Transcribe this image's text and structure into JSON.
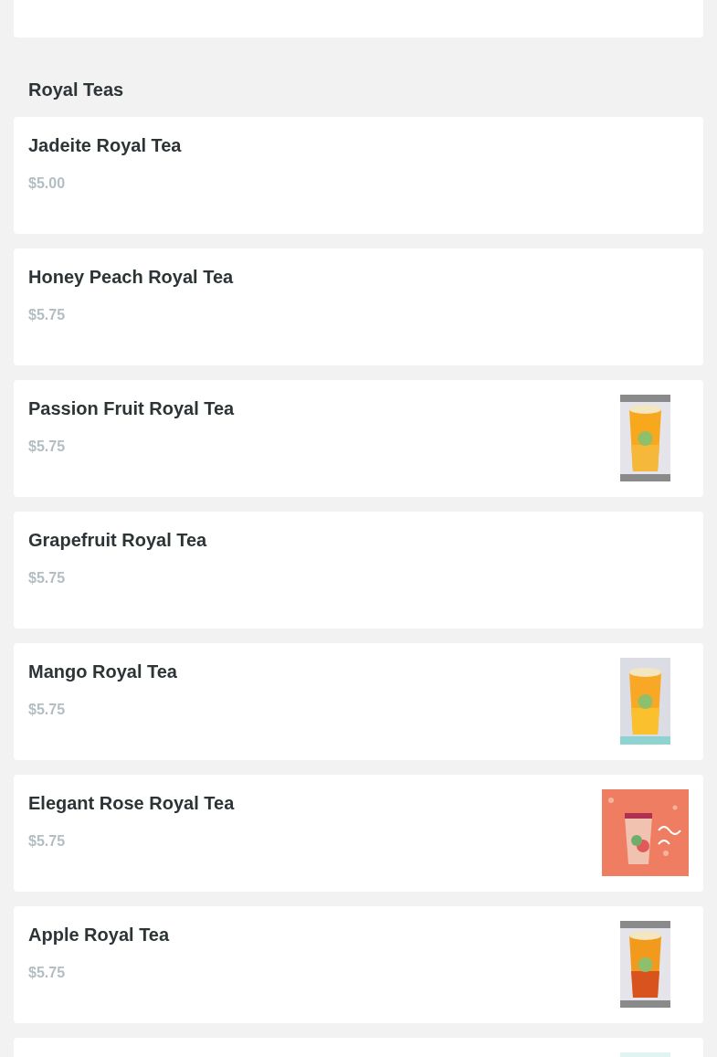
{
  "section": {
    "title": "Royal Teas"
  },
  "items": [
    {
      "name": "Jadeite Royal Tea",
      "price": "$5.00"
    },
    {
      "name": "Honey Peach Royal Tea",
      "price": "$5.75"
    },
    {
      "name": "Passion Fruit Royal Tea",
      "price": "$5.75",
      "photo": {
        "kind": "picture"
      }
    },
    {
      "name": "Grapefruit Royal Tea",
      "price": "$5.75"
    },
    {
      "name": "Mango Royal Tea",
      "price": "$5.75",
      "photo": {
        "kind": "picture"
      }
    },
    {
      "name": "Elegant Rose Royal Tea",
      "price": "$5.75",
      "photo": {
        "kind": "picture"
      }
    },
    {
      "name": "Apple Royal Tea",
      "price": "$5.75",
      "photo": {
        "kind": "picture"
      }
    },
    {
      "photo": {
        "kind": "picture"
      }
    }
  ]
}
